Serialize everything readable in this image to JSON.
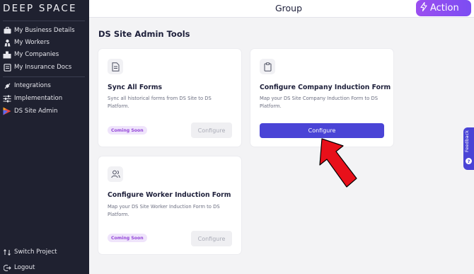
{
  "app": {
    "logo_text": "DEEP SPACE"
  },
  "header": {
    "title": "Group",
    "action_label": "Action"
  },
  "sidebar": {
    "items": [
      {
        "label": "My Business Details",
        "icon": "briefcase-icon"
      },
      {
        "label": "My Workers",
        "icon": "users-icon"
      },
      {
        "label": "My Companies",
        "icon": "building-icon"
      },
      {
        "label": "My Insurance Docs",
        "icon": "document-icon"
      },
      {
        "label": "Integrations",
        "icon": "plug-icon"
      },
      {
        "label": "Implementation",
        "icon": "sliders-icon"
      },
      {
        "label": "DS Site Admin",
        "icon": "ds-logo-icon"
      }
    ],
    "footer": [
      {
        "label": "Switch Project",
        "icon": "switch-icon"
      },
      {
        "label": "Logout",
        "icon": "logout-icon"
      }
    ]
  },
  "main": {
    "title": "DS Site Admin Tools",
    "cards": [
      {
        "title": "Sync All Forms",
        "description": "Sync all historical forms from DS Site to DS Platform.",
        "badge": "Coming Soon",
        "button": "Configure",
        "icon": "document-icon"
      },
      {
        "title": "Configure Company Induction Form",
        "description": "Map your DS Site Company Induction Form to DS Platform.",
        "button": "Configure",
        "icon": "clipboard-icon"
      },
      {
        "title": "Configure Worker Induction Form",
        "description": "Map your DS Site Worker Induction Form to DS Platform.",
        "badge": "Coming Soon",
        "button": "Configure",
        "icon": "users-icon"
      }
    ]
  },
  "feedback": {
    "label": "Feedback"
  },
  "colors": {
    "sidebar_bg": "#1f2130",
    "primary": "#4a44d6",
    "action_gradient_start": "#9b4ef0",
    "badge_text": "#9447d8",
    "arrow": "#e8101a"
  }
}
